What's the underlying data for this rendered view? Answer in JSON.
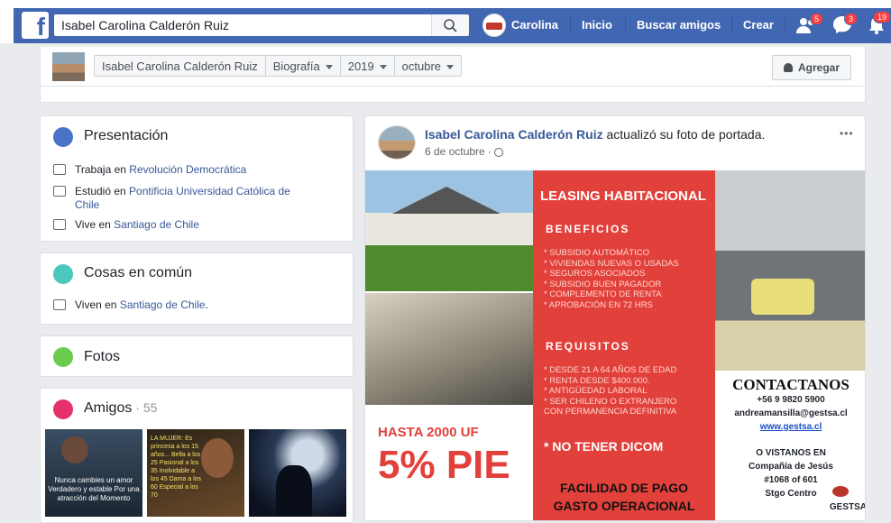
{
  "search": {
    "value": "Isabel Carolina Calderón Ruiz"
  },
  "topnav": {
    "user": "Carolina",
    "home": "Inicio",
    "find_friends": "Buscar amigos",
    "create": "Crear",
    "friend_requests_count": "5",
    "messages_count": "3",
    "notifications_count": "19"
  },
  "profile_nav": {
    "name": "Isabel Carolina Calderón Ruiz",
    "section": "Biografía",
    "year": "2019",
    "month": "octubre",
    "add_button": "Agregar"
  },
  "intro": {
    "title": "Presentación",
    "work_prefix": "Trabaja en ",
    "work": "Revolución Democrática",
    "study_prefix": "Estudió en ",
    "study_line1": "Pontificia Universidad Católica de",
    "study_line2": "Chile",
    "lives_prefix": "Vive en ",
    "lives": "Santiago de Chile"
  },
  "common": {
    "title": "Cosas en común",
    "prefix": "Viven en ",
    "place": "Santiago de Chile",
    "suffix": "."
  },
  "photos": {
    "title": "Fotos"
  },
  "friends": {
    "title": "Amigos",
    "sep": " · ",
    "count": "55"
  },
  "post": {
    "author": "Isabel Carolina Calderón Ruiz",
    "action": " actualizó su foto de portada.",
    "date": "6 de octubre",
    "dot": " · ",
    "menu": "•••",
    "ad": {
      "headline": "LEASING HABITACIONAL",
      "benefits_title": "BENEFICIOS",
      "benefits": [
        "* SUBSIDIO AUTOMÁTICO",
        "* VIVIENDAS NUEVAS O USADAS",
        "* SEGUROS ASOCIADOS",
        "* SUBSIDIO BUEN PAGADOR",
        "* COMPLEMENTO DE RENTA",
        "* APROBACIÓN EN 72 HRS"
      ],
      "req_title": "REQUISITOS",
      "requirements": [
        "* DESDE 21 A 64 AÑOS DE EDAD",
        "* RENTA DESDE $400.000.",
        "* ANTIGÜEDAD LABORAL",
        "* SER CHILENO O EXTRANJERO",
        "CON PERMANENCIA DEFINITIVA"
      ],
      "no_dicom": "* NO TENER DICOM",
      "facility1": "FACILIDAD DE PAGO",
      "facility2": "GASTO OPERACIONAL",
      "hasta": "HASTA 2000 UF",
      "pie": "5% PIE",
      "contact_title": "CONTACTANOS",
      "phone": "+56 9 9820 5900",
      "email": "andreamansilla@gestsa.cl",
      "web": "www.gestsa.cl",
      "visit1": "O VISTANOS EN",
      "visit2": "Compañía de Jesús",
      "visit3": "#1068 of 601",
      "visit4": "Stgo Centro",
      "brand": "GESTSA",
      "accent_red": "#e2403b"
    }
  },
  "friend_thumbs": [
    {
      "text": "Nunca cambies un amor Verdadero y estable Por una atracción del Momento"
    },
    {
      "text": "LA MUJER: Es princesa a los 15 años... Bella a los 25 Pasional a los 35 Inolvidable a los 45 Dama a los 60 Especial a los 70"
    },
    {
      "text": ""
    }
  ]
}
